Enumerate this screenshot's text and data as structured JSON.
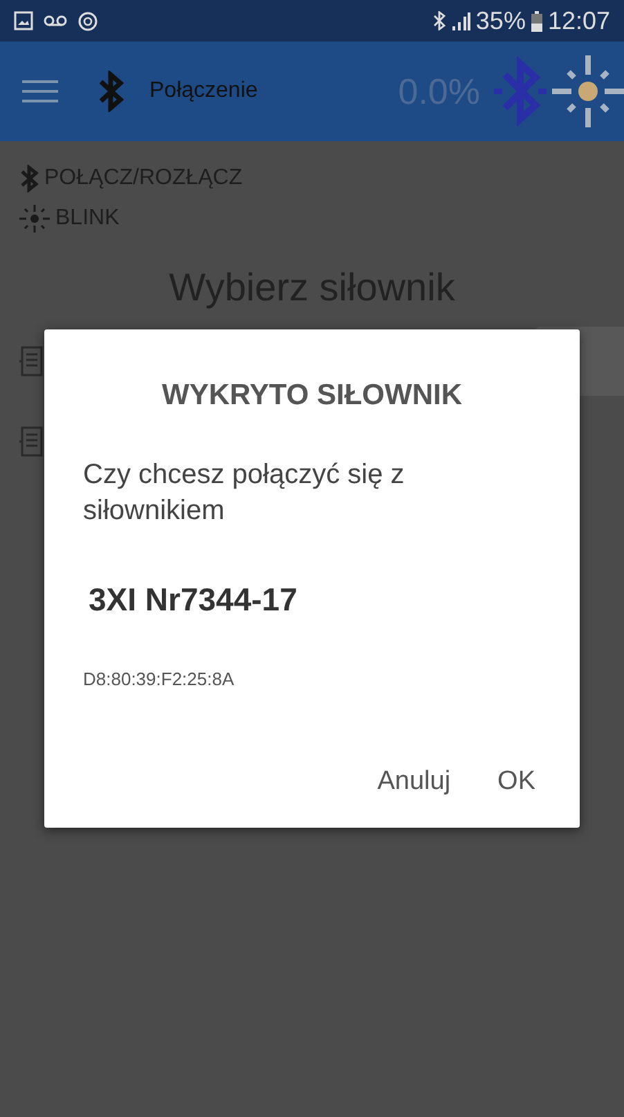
{
  "status_bar": {
    "battery": "35%",
    "time": "12:07"
  },
  "app_bar": {
    "title": "Połączenie",
    "progress": "0.0%"
  },
  "menu": [
    {
      "kind": "bluetooth",
      "label": "POŁĄCZ/ROZŁĄCZ"
    },
    {
      "kind": "blink",
      "label": "BLINK"
    }
  ],
  "heading": "Wybierz siłownik",
  "dialog": {
    "title": "WYKRYTO SIŁOWNIK",
    "message": "Czy chcesz połączyć się z siłownikiem",
    "device_name": "3XI Nr7344-17",
    "address": "D8:80:39:F2:25:8A",
    "buttons": [
      "Anuluj",
      "OK"
    ]
  }
}
